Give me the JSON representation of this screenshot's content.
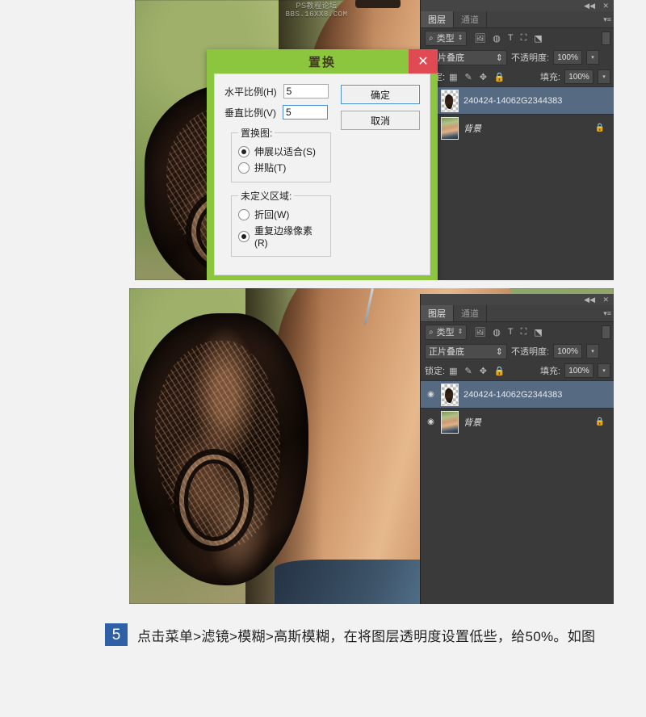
{
  "watermark": {
    "line1": "PS教程论坛",
    "line2": "BBS.16XX8.COM"
  },
  "dialog": {
    "title": "置换",
    "close_label": "✕",
    "fields": [
      {
        "label": "水平比例(H)",
        "value": "5",
        "focused": false
      },
      {
        "label": "垂直比例(V)",
        "value": "5",
        "focused": true
      }
    ],
    "groups": [
      {
        "legend": "置换图:",
        "options": [
          {
            "label": "伸展以适合(S)",
            "selected": true
          },
          {
            "label": "拼贴(T)",
            "selected": false
          }
        ]
      },
      {
        "legend": "未定义区域:",
        "options": [
          {
            "label": "折回(W)",
            "selected": false
          },
          {
            "label": "重复边缘像素(R)",
            "selected": true
          }
        ]
      }
    ],
    "buttons": [
      {
        "label": "确定",
        "primary": true
      },
      {
        "label": "取消",
        "primary": false
      }
    ]
  },
  "layers_panel": {
    "tabs": [
      {
        "label": "图层",
        "active": true
      },
      {
        "label": "通道",
        "active": false
      }
    ],
    "panel_menu_icon": "panel-menu-icon",
    "collapse_icon": "◀◀",
    "close_icon": "✕",
    "filter": {
      "icon": "search-icon",
      "label": "类型",
      "spinner": "⇕"
    },
    "filter_icons": [
      "image-filter-icon",
      "adjustment-filter-icon",
      "type-filter-icon",
      "shape-filter-icon",
      "smart-object-filter-icon"
    ],
    "blend_mode": "正片叠底",
    "blend_arrow": "⇕",
    "opacity_label": "不透明度:",
    "opacity_value": "100%",
    "lock_label": "锁定:",
    "lock_icons": [
      "lock-transparency-icon",
      "lock-image-icon",
      "lock-position-icon",
      "lock-all-icon"
    ],
    "fill_label": "填充:",
    "fill_value": "100%",
    "dropdown_arrow": "▾",
    "layers": [
      {
        "name": "240424-14062G2344383",
        "visible": true,
        "eye_icon": "eye-icon",
        "selected": true,
        "locked": false,
        "italic": false,
        "thumb": "transparent-mark"
      },
      {
        "name": "背景",
        "visible": true,
        "eye_icon": "eye-icon",
        "selected": false,
        "locked": true,
        "lock_icon": "lock-icon",
        "italic": true,
        "thumb": "photo"
      }
    ]
  },
  "caption": {
    "badge": "5",
    "text": "点击菜单>滤镜>模糊>高斯模糊，在将图层透明度设置低些，给50%。如图"
  }
}
